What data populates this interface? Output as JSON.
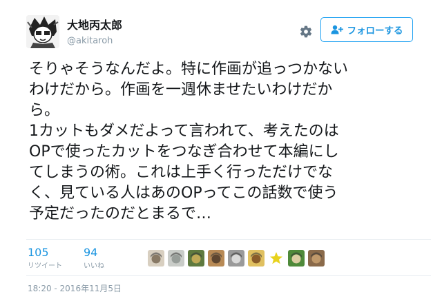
{
  "author": {
    "name": "大地丙太郎",
    "handle": "@akitaroh",
    "avatar_icon": "manga-character-avatar-icon"
  },
  "actions": {
    "settings_icon": "gear-icon",
    "follow_icon": "add-user-icon",
    "follow_label": "フォローする"
  },
  "tweet": {
    "lines": [
      "そりゃそうなんだよ。特に作画が追っつかない",
      "わけだから。作画を一週休ませたいわけだか",
      "ら。",
      "1カットもダメだよって言われて、考えたのは",
      "OPで使ったカットをつなぎ合わせて本編にし",
      "てしまうの術。これは上手く行っただけでな",
      "く、見ている人はあのOPってこの話数で使う",
      "予定だったのだとまるで…"
    ]
  },
  "stats": {
    "retweets": {
      "count": "105",
      "label": "リツイート"
    },
    "likes": {
      "count": "94",
      "label": "いいね"
    }
  },
  "likers": [
    {
      "name": "liker-avatar-1",
      "color": "#d8cfc0",
      "accent": "#7a6a55"
    },
    {
      "name": "liker-avatar-2",
      "color": "#c9ccc8",
      "accent": "#8e9490"
    },
    {
      "name": "liker-avatar-3",
      "color": "#5f7a3f",
      "accent": "#d0b15a"
    },
    {
      "name": "liker-avatar-4",
      "color": "#b88a55",
      "accent": "#4e3a2a"
    },
    {
      "name": "liker-avatar-5",
      "color": "#9a9a9a",
      "accent": "#e5e5e5"
    },
    {
      "name": "liker-avatar-6",
      "color": "#e0c060",
      "accent": "#7a4a20"
    },
    {
      "name": "liker-avatar-7",
      "color": "#ffffff",
      "accent": "#e8d21c"
    },
    {
      "name": "liker-avatar-8",
      "color": "#4f8a3a",
      "accent": "#f3d9b6"
    },
    {
      "name": "liker-avatar-9",
      "color": "#8a6a4a",
      "accent": "#c8a070"
    }
  ],
  "timestamp": "18:20 - 2016年11月5日",
  "colors": {
    "accent": "#1b95e0",
    "muted": "#8899a6",
    "text": "#14171a",
    "divider": "#e6ecf0"
  }
}
